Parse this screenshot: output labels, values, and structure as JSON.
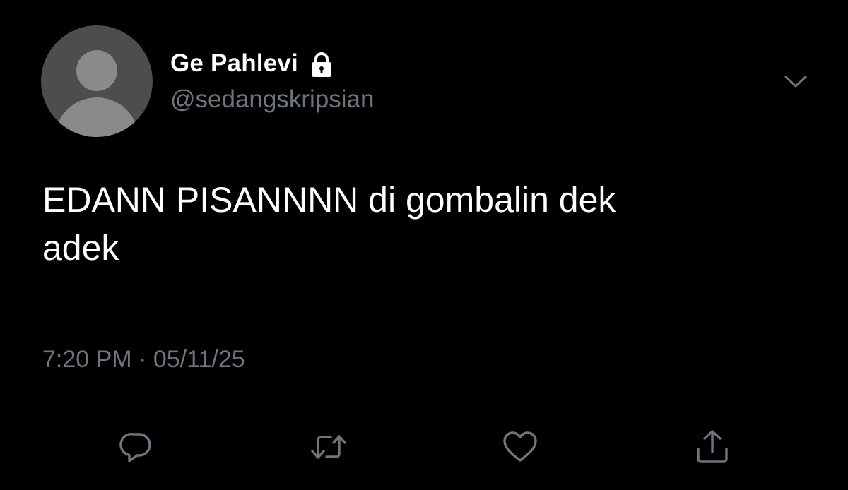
{
  "tweet": {
    "author": {
      "display_name": "Ge Pahlevi",
      "handle": "@sedangskripsian",
      "avatar": "default-avatar-icon",
      "badge": "lock-icon"
    },
    "text": "EDANN PISANNNN di gombalin dek\nadek",
    "time": "7:20 PM",
    "separator": "·",
    "date": "05/11/25",
    "menu_icon": "chevron-down-icon",
    "actions": [
      {
        "name": "reply",
        "icon": "comment-icon"
      },
      {
        "name": "retweet",
        "icon": "retweet-icon"
      },
      {
        "name": "like",
        "icon": "heart-icon"
      },
      {
        "name": "share",
        "icon": "share-icon"
      }
    ]
  },
  "colors": {
    "background": "#000000",
    "primary_text": "#ffffff",
    "secondary_text": "#6e767d",
    "divider": "#2f3336",
    "avatar_bg": "#4d4d4d",
    "avatar_fg": "#8a8a8a"
  }
}
